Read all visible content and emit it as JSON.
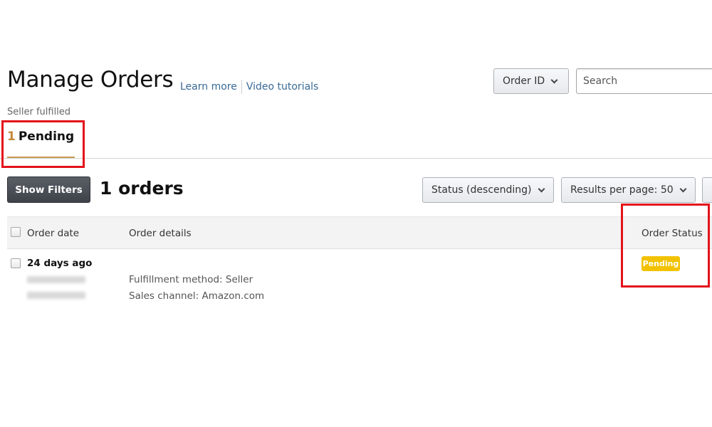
{
  "header": {
    "title": "Manage Orders",
    "links": [
      "Learn more",
      "Video tutorials"
    ],
    "subtitle": "Seller fulfilled"
  },
  "tabs": [
    {
      "count": "1",
      "label": "Pending",
      "active": true
    }
  ],
  "search": {
    "field_select": "Order ID",
    "placeholder": "Search",
    "value": ""
  },
  "toolbar": {
    "show_filters_label": "Show Filters",
    "orders_count": "1 orders",
    "sort_select": "Status (descending)",
    "per_page_select": "Results per page: 50"
  },
  "table": {
    "columns": [
      "Order date",
      "Order details",
      "Order Status"
    ],
    "rows": [
      {
        "date": "24 days ago",
        "details": [
          "Fulfillment method: Seller",
          "Sales channel: Amazon.com"
        ],
        "status": "Pending"
      }
    ]
  },
  "colors": {
    "accent_tab": "#c89a4e",
    "highlight_box": "#e3131b",
    "status_pending": "#f2c200",
    "link": "#3a6a96"
  }
}
